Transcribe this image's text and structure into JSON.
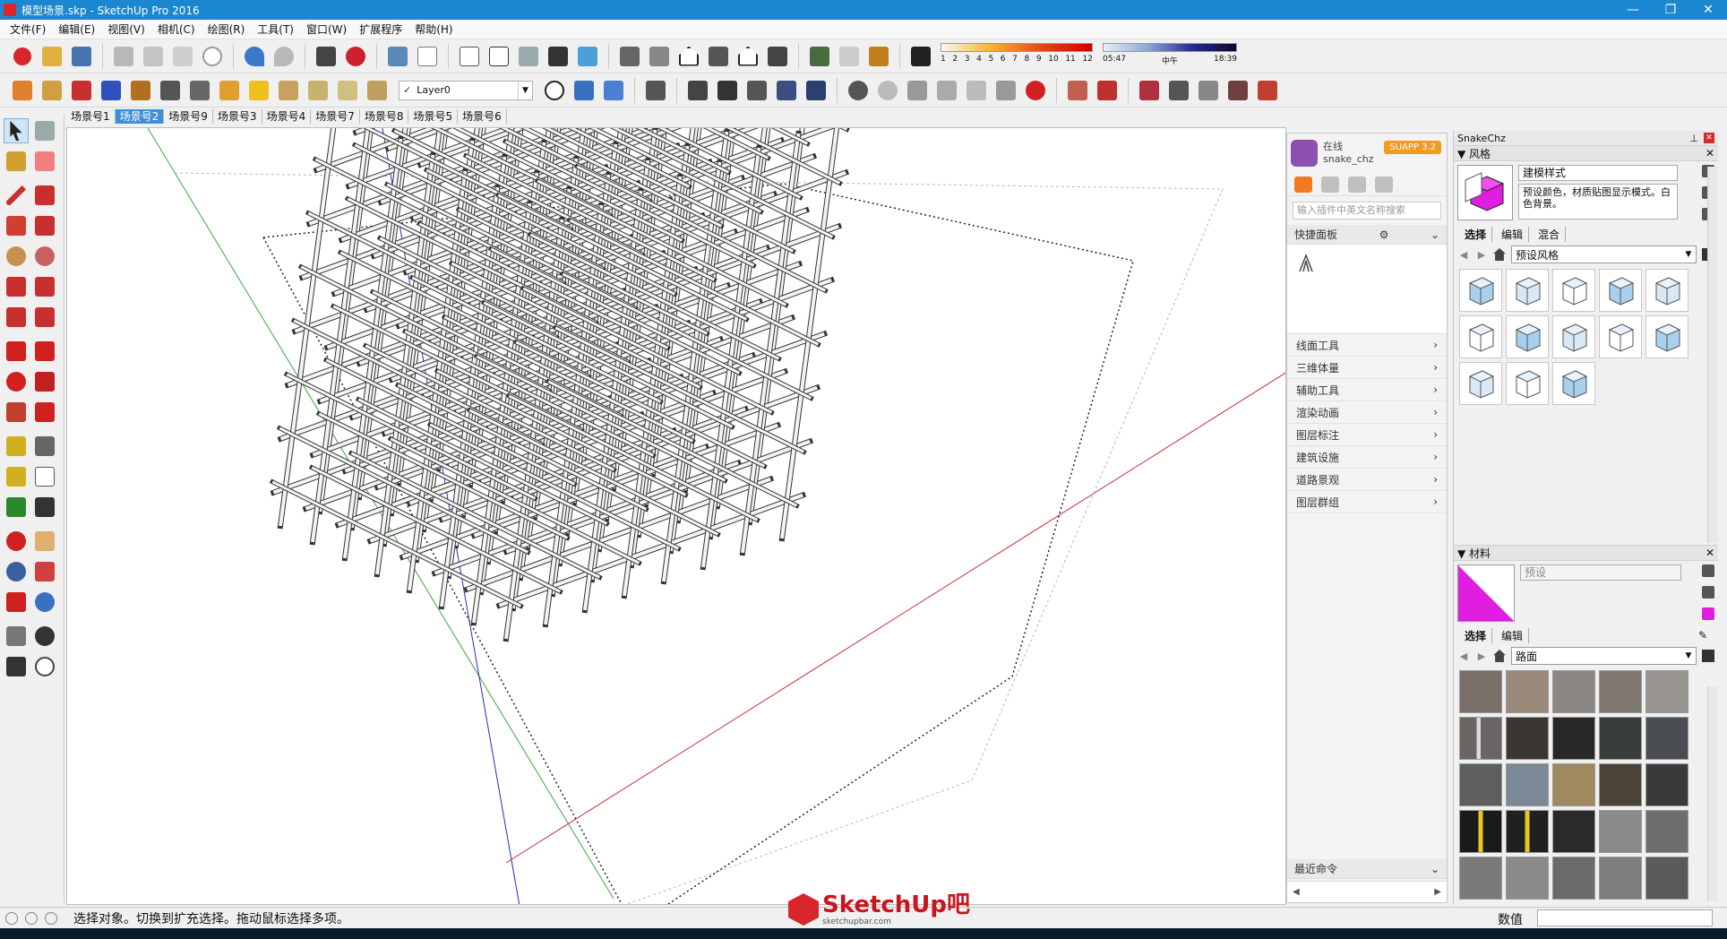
{
  "window": {
    "title": "模型场景.skp - SketchUp Pro 2016",
    "controls": [
      "—",
      "❐",
      "✕"
    ]
  },
  "menu": [
    "文件(F)",
    "编辑(E)",
    "视图(V)",
    "相机(C)",
    "绘图(R)",
    "工具(T)",
    "窗口(W)",
    "扩展程序",
    "帮助(H)"
  ],
  "toolbar": {
    "layer": {
      "check": "✓",
      "name": "Layer0"
    },
    "shadow_months": [
      "1",
      "2",
      "3",
      "4",
      "5",
      "6",
      "7",
      "8",
      "9",
      "10",
      "11",
      "12"
    ],
    "shadow_times": {
      "start": "05:47",
      "mid": "中午",
      "end": "18:39"
    }
  },
  "scenes": {
    "active": "场景号2",
    "tabs": [
      "场景号1",
      "场景号2",
      "场景号9",
      "场景号3",
      "场景号4",
      "场景号7",
      "场景号8",
      "场景号5",
      "场景号6"
    ]
  },
  "plugin": {
    "status": "在线",
    "user": "snake_chz",
    "badge": "SUAPP 3.2",
    "search_placeholder": "输入插件中英文名称搜索",
    "quick_title": "快捷面板",
    "items": [
      "线面工具",
      "三维体量",
      "辅助工具",
      "渲染动画",
      "图层标注",
      "建筑设施",
      "道路景观",
      "图层群组"
    ],
    "recent": "最近命令",
    "arrow": "›",
    "collapse": "⌄"
  },
  "tray": {
    "title": "SnakeChz",
    "styles": {
      "header": "风格",
      "name": "建模样式",
      "description": "预设颜色，材质贴图显示模式。白色背景。",
      "tabs": [
        "选择",
        "编辑",
        "混合"
      ],
      "library": "预设风格"
    },
    "materials": {
      "header": "材料",
      "name": "预设",
      "tabs": [
        "选择",
        "编辑"
      ],
      "library": "路面",
      "swatch_color": "#e01ee0"
    }
  },
  "status": {
    "message": "选择对象。切换到扩充选择。拖动鼠标选择多项。",
    "value_label": "数值"
  },
  "logo": {
    "name": "SketchUp吧",
    "site": "sketchupbar.com"
  },
  "colors": {
    "titlebar": "#1a87d0",
    "active_tab": "#3f8fd8",
    "plugin_badge": "#f29a22",
    "material": "#e01ee0"
  }
}
